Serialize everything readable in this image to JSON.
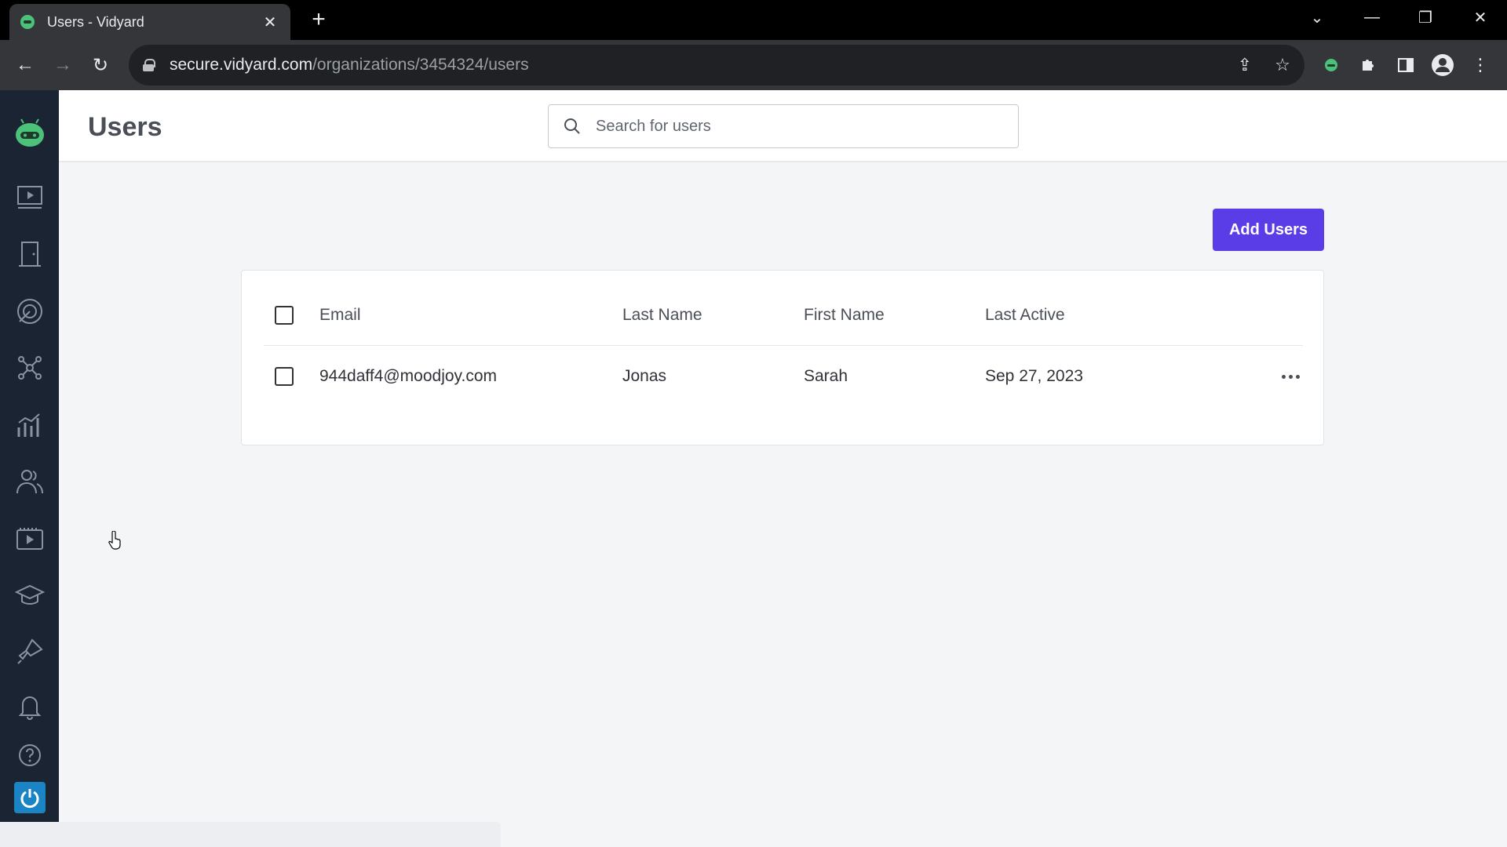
{
  "browser": {
    "tab_title": "Users - Vidyard",
    "url_host": "secure.vidyard.com",
    "url_path": "/organizations/3454324/users"
  },
  "header": {
    "title": "Users",
    "search_placeholder": "Search for users"
  },
  "actions": {
    "add_users_label": "Add Users"
  },
  "table": {
    "columns": [
      "Email",
      "Last Name",
      "First Name",
      "Last Active"
    ],
    "rows": [
      {
        "email": "944daff4@moodjoy.com",
        "last_name": "Jonas",
        "first_name": "Sarah",
        "last_active": "Sep 27, 2023"
      }
    ]
  },
  "sidebar": {
    "items": [
      "videos-icon",
      "door-icon",
      "target-icon",
      "integrations-icon",
      "analytics-icon",
      "users-icon",
      "library-icon",
      "learning-icon",
      "launch-icon",
      "bell-icon",
      "help-icon"
    ]
  },
  "colors": {
    "primary_button": "#5b3de8",
    "sidebar_bg": "#1b2432",
    "logo_green": "#4cc17a"
  }
}
